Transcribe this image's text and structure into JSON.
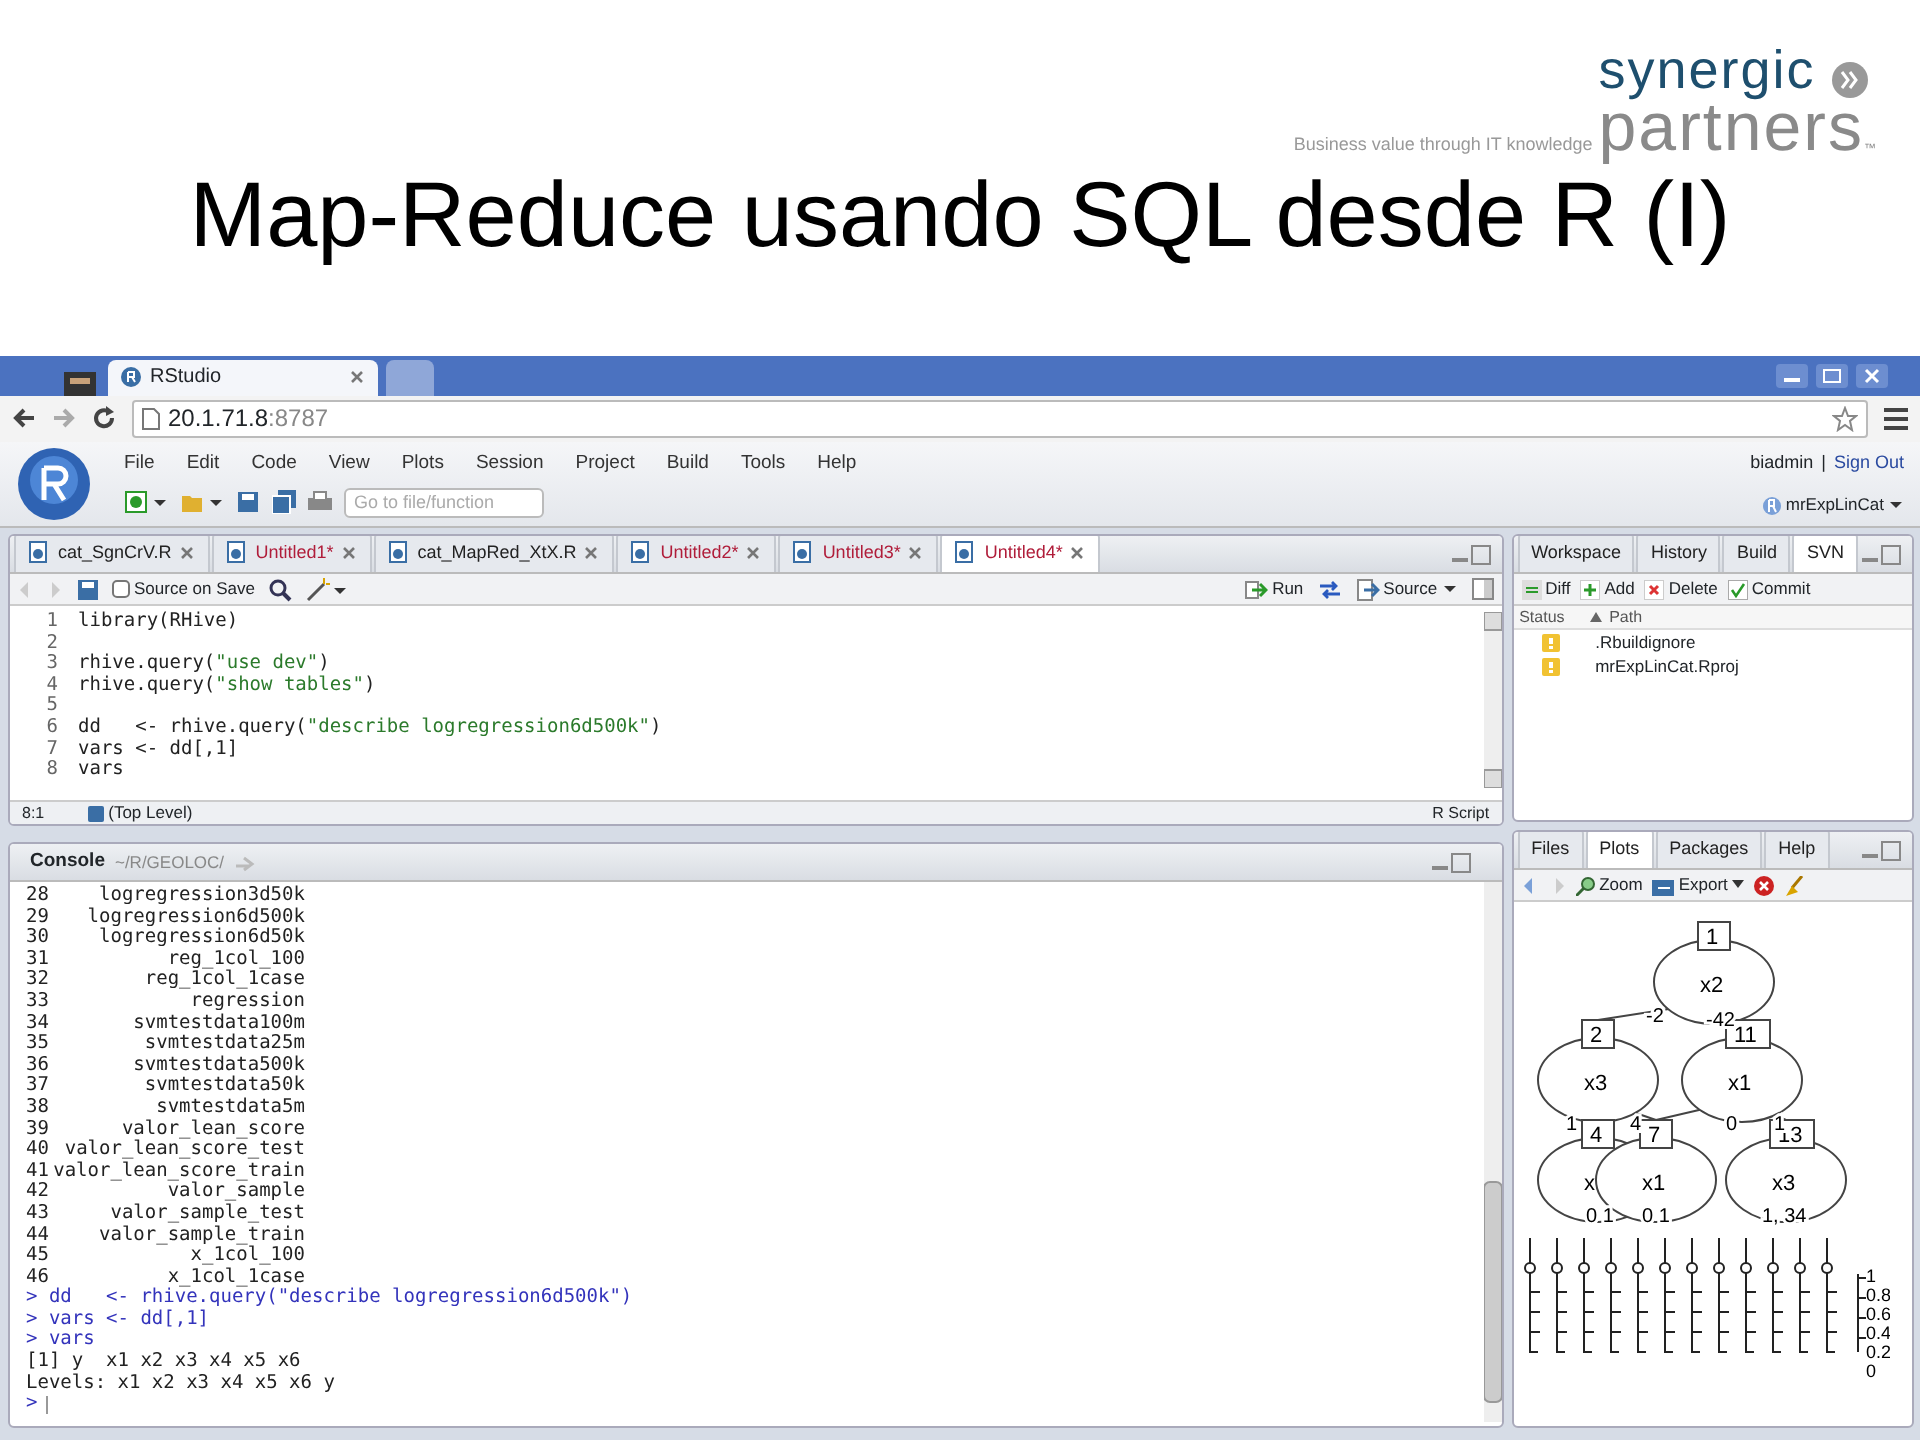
{
  "slide": {
    "title": "Map-Reduce usando SQL desde R (I)",
    "logo": {
      "word_1": "synergic",
      "word_2": "partners",
      "tagline": "Business value through IT knowledge",
      "trademark": "™"
    }
  },
  "browser": {
    "tabs": [
      {
        "label": "RStudio",
        "selected": true
      }
    ],
    "address": {
      "host": "20.1.71.8",
      "port": ":8787"
    }
  },
  "rstudio": {
    "menu": [
      "File",
      "Edit",
      "Code",
      "View",
      "Plots",
      "Session",
      "Project",
      "Build",
      "Tools",
      "Help"
    ],
    "user": "biadmin",
    "separator": "|",
    "sign_out": "Sign Out",
    "search_placeholder": "Go to file/function",
    "project": "mrExpLinCat"
  },
  "editor": {
    "tabs": [
      {
        "label": "cat_SgnCrV.R",
        "modified": false,
        "selected": false
      },
      {
        "label": "Untitled1*",
        "modified": true,
        "selected": false
      },
      {
        "label": "cat_MapRed_XtX.R",
        "modified": false,
        "selected": false
      },
      {
        "label": "Untitled2*",
        "modified": true,
        "selected": false
      },
      {
        "label": "Untitled3*",
        "modified": true,
        "selected": false
      },
      {
        "label": "Untitled4*",
        "modified": true,
        "selected": true
      }
    ],
    "source_on_save": {
      "label": "Source on Save",
      "checked": false
    },
    "run": "Run",
    "source": "Source",
    "lines": [
      {
        "number": "1",
        "code": "library(RHive)"
      },
      {
        "number": "2"
      },
      {
        "number": "3",
        "code": "rhive.query(\"use dev\")"
      },
      {
        "number": "4",
        "code": "rhive.query(\"show tables\")"
      },
      {
        "number": "5"
      },
      {
        "number": "6",
        "code": "dd   <- rhive.query(\"describe logregression6d500k\")"
      },
      {
        "number": "7",
        "code": "vars <- dd[,1]"
      },
      {
        "number": "8",
        "code": "vars"
      }
    ],
    "position": "8:1",
    "scope": "(Top Level)",
    "file_type": "R Script"
  },
  "console": {
    "title": "Console",
    "path": "~/R/GEOLOC/",
    "lines": [
      {
        "kind": "row",
        "number": "28",
        "value": "logregression3d50k"
      },
      {
        "kind": "row",
        "number": "29",
        "value": "logregression6d500k"
      },
      {
        "kind": "row",
        "number": "30",
        "value": "logregression6d50k"
      },
      {
        "kind": "row",
        "number": "31",
        "value": "reg_1col_100"
      },
      {
        "kind": "row",
        "number": "32",
        "value": "reg_1col_1case"
      },
      {
        "kind": "row",
        "number": "33",
        "value": "regression"
      },
      {
        "kind": "row",
        "number": "34",
        "value": "svmtestdata100m"
      },
      {
        "kind": "row",
        "number": "35",
        "value": "svmtestdata25m"
      },
      {
        "kind": "row",
        "number": "36",
        "value": "svmtestdata500k"
      },
      {
        "kind": "row",
        "number": "37",
        "value": "svmtestdata50k"
      },
      {
        "kind": "row",
        "number": "38",
        "value": "svmtestdata5m"
      },
      {
        "kind": "row",
        "number": "39",
        "value": "valor_lean_score"
      },
      {
        "kind": "row",
        "number": "40",
        "value": "valor_lean_score_test"
      },
      {
        "kind": "row",
        "number": "41",
        "value": "valor_lean_score_train"
      },
      {
        "kind": "row",
        "number": "42",
        "value": "valor_sample"
      },
      {
        "kind": "row",
        "number": "43",
        "value": "valor_sample_test"
      },
      {
        "kind": "row",
        "number": "44",
        "value": "valor_sample_train"
      },
      {
        "kind": "row",
        "number": "45",
        "value": "x_1col_100"
      },
      {
        "kind": "row",
        "number": "46",
        "value": "x_1col_1case"
      },
      {
        "kind": "command",
        "text": "> dd   <- rhive.query(\"describe logregression6d500k\")"
      },
      {
        "kind": "command",
        "text": "> vars <- dd[,1]"
      },
      {
        "kind": "command",
        "text": "> vars"
      },
      {
        "kind": "output",
        "text": "[1] y  x1 x2 x3 x4 x5 x6"
      },
      {
        "kind": "output",
        "text": "Levels: x1 x2 x3 x4 x5 x6 y"
      },
      {
        "kind": "prompt",
        "text": ">"
      }
    ]
  },
  "svn_pane": {
    "tabs": [
      {
        "label": "Workspace",
        "selected": false
      },
      {
        "label": "History",
        "selected": false
      },
      {
        "label": "Build",
        "selected": false
      },
      {
        "label": "SVN",
        "selected": true
      }
    ],
    "actions": [
      {
        "kind": "diff",
        "label": "Diff"
      },
      {
        "kind": "add",
        "label": "Add"
      },
      {
        "kind": "delete",
        "label": "Delete"
      },
      {
        "kind": "commit",
        "label": "Commit"
      }
    ],
    "columns": [
      "Status",
      "Path"
    ],
    "rows": [
      {
        "path": ".Rbuildignore"
      },
      {
        "path": "mrExpLinCat.Rproj"
      }
    ]
  },
  "plots_pane": {
    "tabs": [
      {
        "label": "Files",
        "selected": false
      },
      {
        "label": "Plots",
        "selected": true
      },
      {
        "label": "Packages",
        "selected": false
      },
      {
        "label": "Help",
        "selected": false
      }
    ],
    "zoom": "Zoom",
    "export": "Export",
    "tree": {
      "nodes": [
        {
          "number": "1",
          "variable": "x2"
        },
        {
          "number": "2",
          "variable": "x3"
        },
        {
          "number": "11",
          "variable": "x1"
        },
        {
          "number": "4",
          "variable": "x"
        },
        {
          "number": "7",
          "variable": "x1"
        },
        {
          "number": "13",
          "variable": "x3"
        }
      ],
      "edge_labels": [
        "-2",
        "-42",
        "1",
        "4",
        "0",
        "1",
        "0 1",
        "0 1",
        "1, 34"
      ],
      "axis_labels": [
        "1",
        "0.8",
        "0.6",
        "0.4",
        "0.2",
        "0"
      ]
    }
  }
}
